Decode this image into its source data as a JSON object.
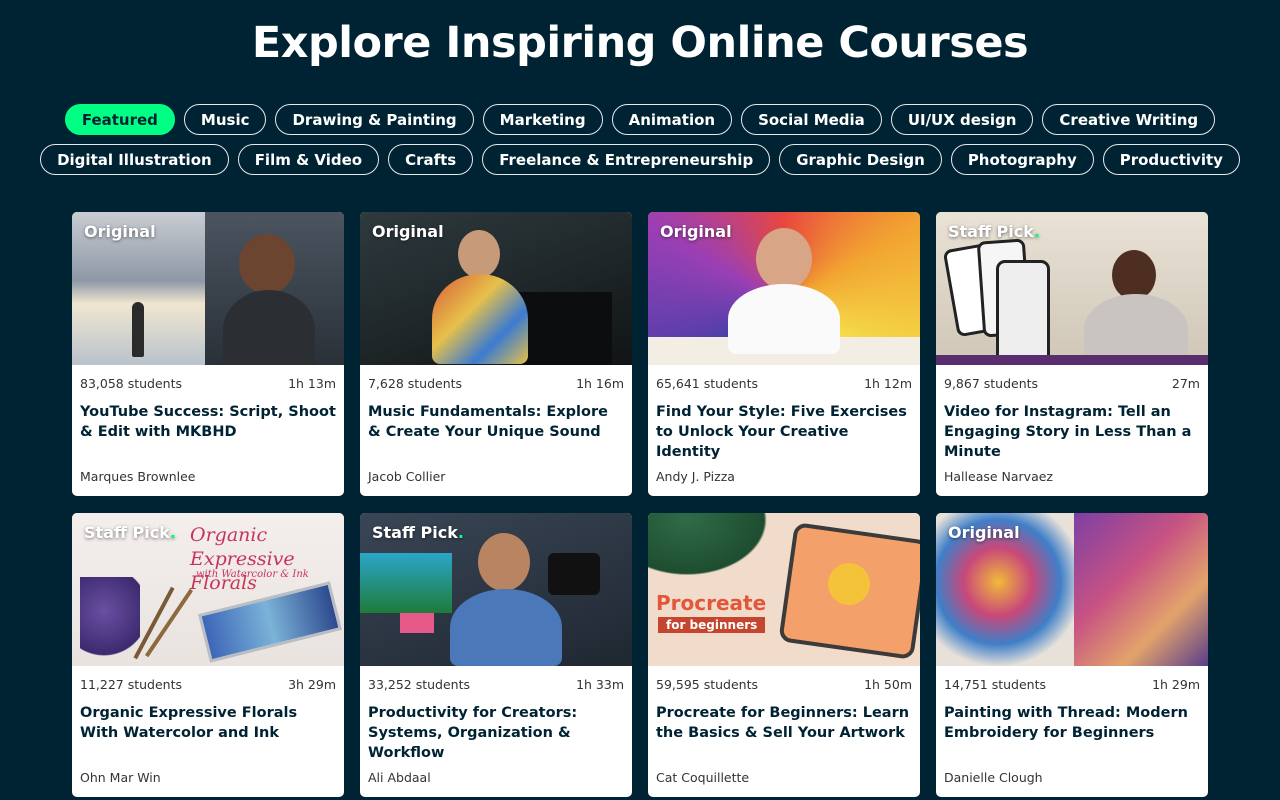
{
  "page": {
    "title": "Explore Inspiring Online Courses"
  },
  "colors": {
    "background": "#002333",
    "accent": "#00ff84",
    "card": "#ffffff"
  },
  "categories": {
    "row1": [
      "Featured",
      "Music",
      "Drawing & Painting",
      "Marketing",
      "Animation",
      "Social Media",
      "UI/UX design",
      "Creative Writing"
    ],
    "row2": [
      "Digital Illustration",
      "Film & Video",
      "Crafts",
      "Freelance & Entrepreneurship",
      "Graphic Design",
      "Photography",
      "Productivity"
    ],
    "active": "Featured"
  },
  "courses": [
    {
      "badge": "Original",
      "students": "83,058 students",
      "duration": "1h 13m",
      "title": "YouTube Success: Script, Shoot & Edit with MKBHD",
      "teacher": "Marques Brownlee"
    },
    {
      "badge": "Original",
      "students": "7,628 students",
      "duration": "1h 16m",
      "title": "Music Fundamentals: Explore & Create Your Unique Sound",
      "teacher": "Jacob Collier"
    },
    {
      "badge": "Original",
      "students": "65,641 students",
      "duration": "1h 12m",
      "title": "Find Your Style: Five Exercises to Unlock Your Creative Identity",
      "teacher": "Andy J. Pizza"
    },
    {
      "badge": "Staff Pick",
      "students": "9,867 students",
      "duration": "27m",
      "title": "Video for Instagram: Tell an Engaging Story in Less Than a Minute",
      "teacher": "Hallease Narvaez"
    },
    {
      "badge": "Staff Pick",
      "students": "11,227 students",
      "duration": "3h 29m",
      "title": "Organic Expressive Florals With Watercolor and Ink",
      "teacher": "Ohn Mar Win",
      "thumb_text": "Organic Expressive Florals",
      "thumb_sub": "with Watercolor & Ink"
    },
    {
      "badge": "Staff Pick",
      "students": "33,252 students",
      "duration": "1h 33m",
      "title": "Productivity for Creators: Systems, Organization & Workflow",
      "teacher": "Ali Abdaal"
    },
    {
      "badge": "",
      "students": "59,595 students",
      "duration": "1h 50m",
      "title": "Procreate for Beginners: Learn the Basics & Sell Your Artwork",
      "teacher": "Cat Coquillette",
      "thumb_text": "Procreate",
      "thumb_sub": "for beginners"
    },
    {
      "badge": "Original",
      "students": "14,751 students",
      "duration": "1h 29m",
      "title": "Painting with Thread: Modern Embroidery for Beginners",
      "teacher": "Danielle Clough"
    }
  ]
}
